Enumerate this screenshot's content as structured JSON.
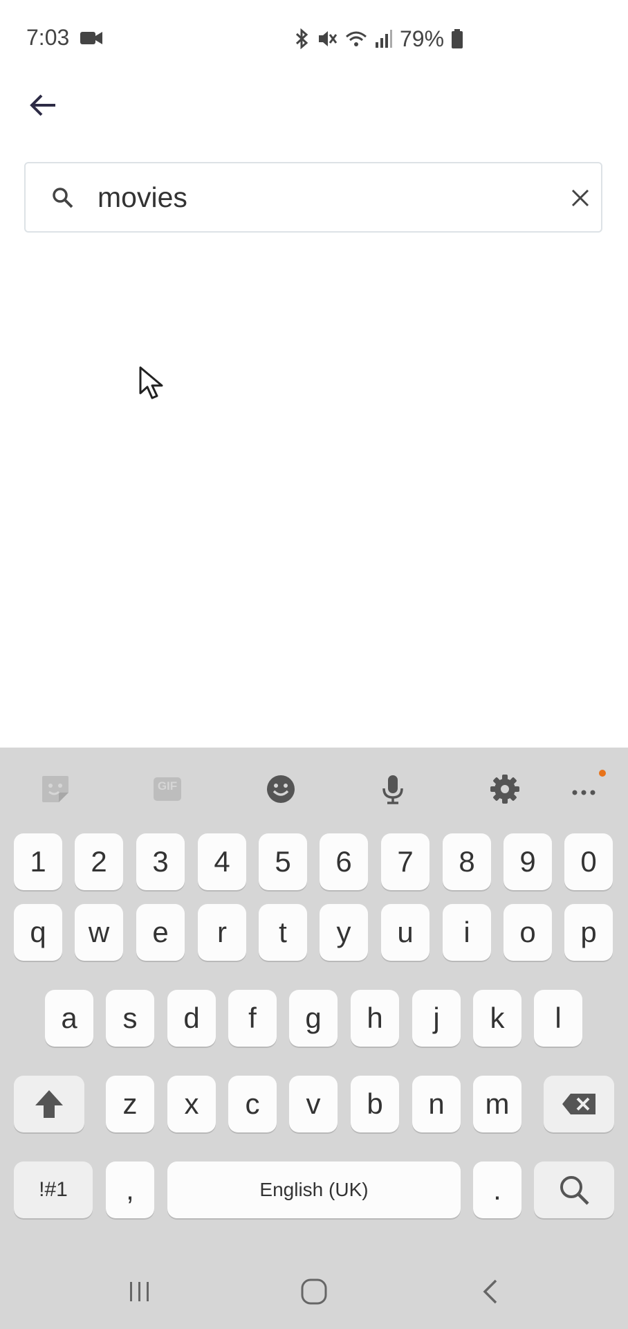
{
  "status_bar": {
    "time": "7:03",
    "battery_percent": "79%",
    "icons": [
      "video-camera-icon",
      "bluetooth-icon",
      "mute-icon",
      "wifi-icon",
      "signal-icon",
      "battery-icon"
    ]
  },
  "header": {
    "back_icon": "back-arrow-icon"
  },
  "search": {
    "value": "movies",
    "search_icon": "search-icon",
    "clear_icon": "close-icon"
  },
  "keyboard": {
    "toolbar": [
      "sticker-icon",
      "gif-icon",
      "emoji-icon",
      "mic-icon",
      "settings-icon",
      "more-icon"
    ],
    "gif_label": "GIF",
    "number_row": [
      "1",
      "2",
      "3",
      "4",
      "5",
      "6",
      "7",
      "8",
      "9",
      "0"
    ],
    "row1": [
      "q",
      "w",
      "e",
      "r",
      "t",
      "y",
      "u",
      "i",
      "o",
      "p"
    ],
    "row2": [
      "a",
      "s",
      "d",
      "f",
      "g",
      "h",
      "j",
      "k",
      "l"
    ],
    "row3": [
      "z",
      "x",
      "c",
      "v",
      "b",
      "n",
      "m"
    ],
    "symbols_label": "!#1",
    "comma_label": ",",
    "space_label": "English (UK)",
    "period_label": ".",
    "accent_color": "#e8731a"
  },
  "nav_bar": {
    "icons": [
      "recents-icon",
      "home-icon",
      "back-icon"
    ]
  }
}
